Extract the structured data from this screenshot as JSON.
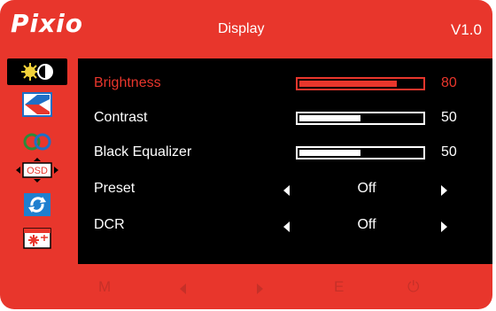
{
  "header": {
    "logo": "Pixio",
    "title": "Display",
    "version": "V1.0"
  },
  "sidebar": {
    "items": [
      {
        "icon": "brightness-contrast-icon",
        "active": true
      },
      {
        "icon": "picture-icon",
        "active": false
      },
      {
        "icon": "color-icon",
        "active": false
      },
      {
        "icon": "osd-icon",
        "active": false
      },
      {
        "icon": "reset-icon",
        "active": false
      },
      {
        "icon": "settings-icon",
        "active": false
      }
    ]
  },
  "menu": {
    "brightness": {
      "label": "Brightness",
      "value": "80",
      "level": 80
    },
    "contrast": {
      "label": "Contrast",
      "value": "50",
      "level": 50
    },
    "black_equalizer": {
      "label": "Black Equalizer",
      "value": "50",
      "level": 50
    },
    "preset": {
      "label": "Preset",
      "value": "Off"
    },
    "dcr": {
      "label": "DCR",
      "value": "Off"
    }
  },
  "footer": {
    "menu_key": "M",
    "exit_key": "E",
    "power_key": "⏻",
    "left_key": "left-arrow-icon",
    "right_key": "right-arrow-icon"
  },
  "colors": {
    "accent": "#e8362c",
    "panel": "#000000",
    "text": "#ffffff",
    "footer_text": "#c63028"
  }
}
